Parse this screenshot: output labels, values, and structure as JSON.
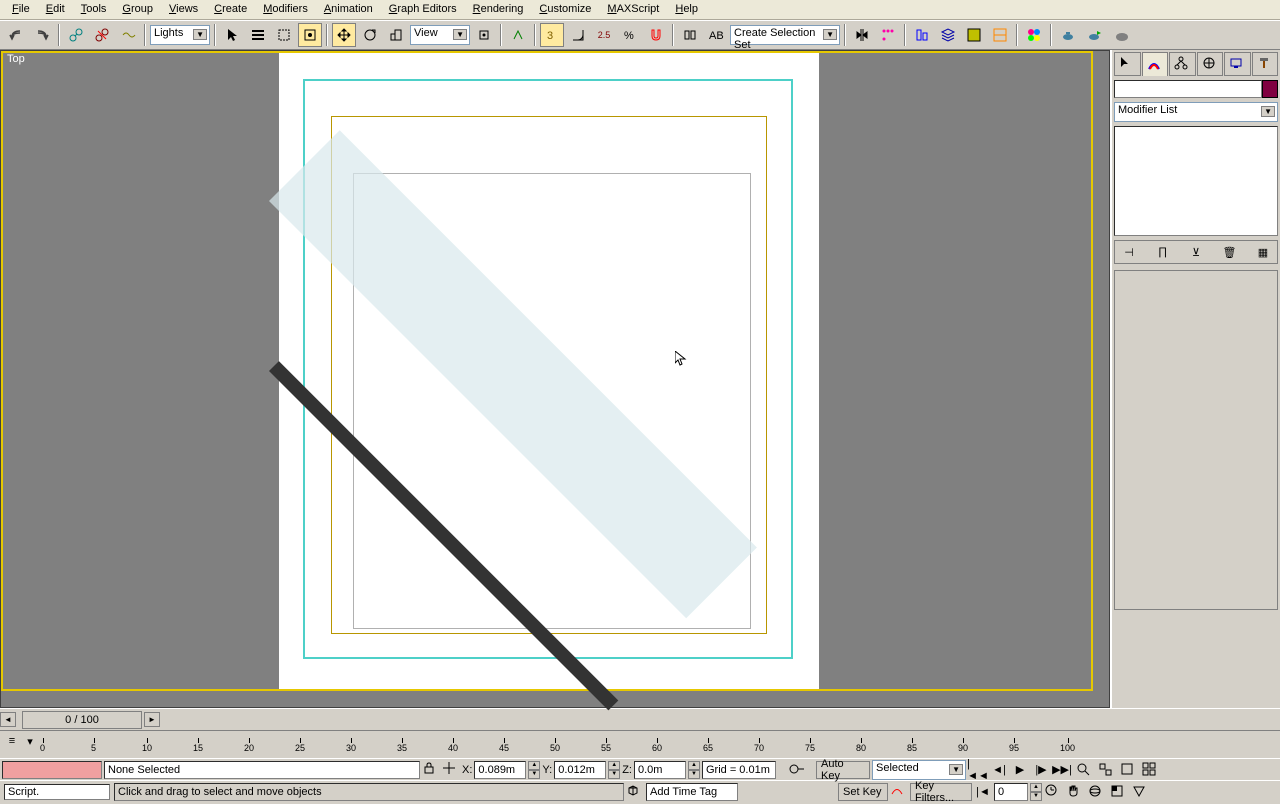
{
  "menu": [
    "File",
    "Edit",
    "Tools",
    "Group",
    "Views",
    "Create",
    "Modifiers",
    "Animation",
    "Graph Editors",
    "Rendering",
    "Customize",
    "MAXScript",
    "Help"
  ],
  "toolbar": {
    "selection_filter": "Lights",
    "ref_coord": "View",
    "named_set": "Create Selection Set",
    "snap_angle": "2.5"
  },
  "viewport": {
    "label": "Top"
  },
  "command_panel": {
    "modifier_dropdown": "Modifier List",
    "name_value": ""
  },
  "timeslider": {
    "label": "0 / 100"
  },
  "ruler_ticks": [
    "0",
    "5",
    "10",
    "15",
    "20",
    "25",
    "30",
    "35",
    "40",
    "45",
    "50",
    "55",
    "60",
    "65",
    "70",
    "75",
    "80",
    "85",
    "90",
    "95",
    "100"
  ],
  "status": {
    "selection": "None Selected",
    "x_label": "X:",
    "x_val": "0.089m",
    "y_label": "Y:",
    "y_val": "0.012m",
    "z_label": "Z:",
    "z_val": "0.0m",
    "grid": "Grid = 0.01m",
    "autokey": "Auto Key",
    "setkey": "Set Key",
    "keymode": "Selected",
    "keyfilters": "Key Filters...",
    "timetag": "Add Time Tag",
    "frame": "0"
  },
  "prompt": {
    "left": "Script.",
    "main": "Click and drag to select and move objects"
  }
}
